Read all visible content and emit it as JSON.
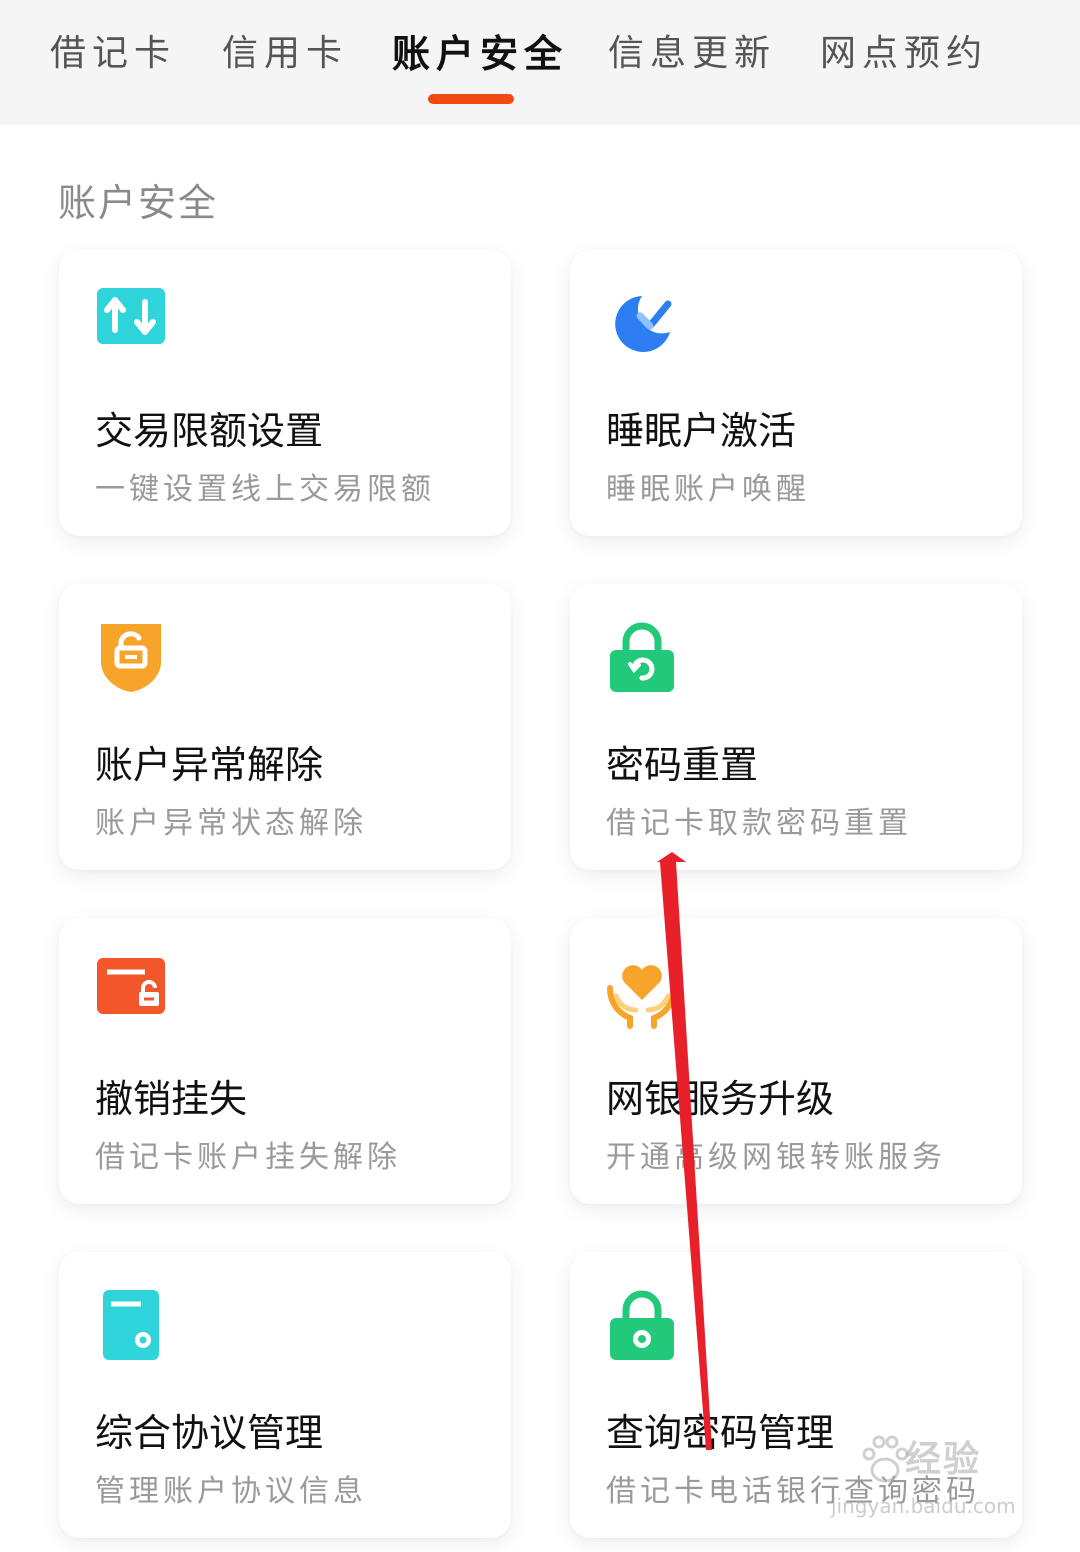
{
  "tabs": [
    {
      "label": "借记卡",
      "active": false
    },
    {
      "label": "信用卡",
      "active": false
    },
    {
      "label": "账户安全",
      "active": true
    },
    {
      "label": "信息更新",
      "active": false
    },
    {
      "label": "网点预约",
      "active": false
    }
  ],
  "section_title": "账户安全",
  "cards": [
    {
      "title": "交易限额设置",
      "subtitle": "一键设置线上交易限额",
      "icon": "transfer-arrows-icon",
      "color": "#2fd3da"
    },
    {
      "title": "睡眠户激活",
      "subtitle": "睡眠账户唤醒",
      "icon": "moon-check-icon",
      "color": "#2c7ef2"
    },
    {
      "title": "账户异常解除",
      "subtitle": "账户异常状态解除",
      "icon": "shield-unlock-icon",
      "color": "#f7a42b"
    },
    {
      "title": "密码重置",
      "subtitle": "借记卡取款密码重置",
      "icon": "lock-reset-icon",
      "color": "#22c97a"
    },
    {
      "title": "撤销挂失",
      "subtitle": "借记卡账户挂失解除",
      "icon": "card-unlock-icon",
      "color": "#f2562a"
    },
    {
      "title": "网银服务升级",
      "subtitle": "开通高级网银转账服务",
      "icon": "hands-heart-icon",
      "color": "#f7a42b"
    },
    {
      "title": "综合协议管理",
      "subtitle": "管理账户协议信息",
      "icon": "card-settings-icon",
      "color": "#2fd3da"
    },
    {
      "title": "查询密码管理",
      "subtitle": "借记卡电话银行查询密码",
      "icon": "lock-settings-icon",
      "color": "#22c97a"
    }
  ],
  "watermark": {
    "text": "经验",
    "url": "jingyan.baidu.com"
  },
  "colors": {
    "accent": "#f04a14",
    "annotation": "#e8202a"
  }
}
